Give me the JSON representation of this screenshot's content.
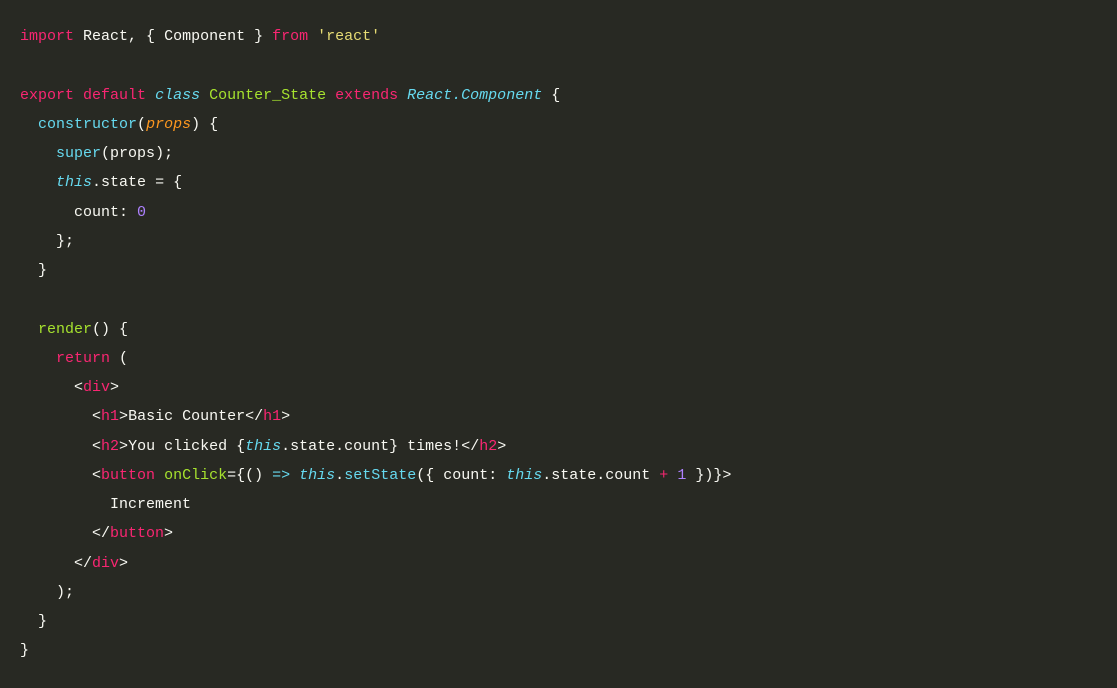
{
  "code": {
    "line1": {
      "import": "import",
      "react": "React",
      "comma": ", { ",
      "component": "Component",
      "close": " } ",
      "from": "from",
      "space": " ",
      "module": "'react'"
    },
    "line3": {
      "export": "export",
      "default": "default",
      "class": "class",
      "className": "Counter_State",
      "extends": "extends",
      "reactComp": "React.Component",
      "brace": " {"
    },
    "line4": {
      "constructor": "constructor",
      "params": "(",
      "props": "props",
      "close": ") {"
    },
    "line5": {
      "super": "super",
      "open": "(",
      "props": "props",
      "close": ");"
    },
    "line6": {
      "this": "this",
      "dot": ".",
      "state": "state",
      "equals": " = {"
    },
    "line7": {
      "count": "count",
      "colon": ": ",
      "zero": "0"
    },
    "line8": {
      "close": "};"
    },
    "line9": {
      "close": "}"
    },
    "line11": {
      "render": "render",
      "parens": "() {"
    },
    "line12": {
      "return": "return",
      "open": " ("
    },
    "line13": {
      "open": "<",
      "div": "div",
      "close": ">"
    },
    "line14": {
      "open1": "<",
      "h1": "h1",
      "close1": ">",
      "text": "Basic Counter",
      "open2": "</",
      "h1b": "h1",
      "close2": ">"
    },
    "line15": {
      "open1": "<",
      "h2": "h2",
      "close1": ">",
      "text1": "You clicked ",
      "braceOpen": "{",
      "this": "this",
      "dotState": ".state.count",
      "braceClose": "}",
      "text2": " times!",
      "open2": "</",
      "h2b": "h2",
      "close2": ">"
    },
    "line16": {
      "open1": "<",
      "button": "button",
      "space": " ",
      "onClick": "onClick",
      "equals": "=",
      "braceOpen": "{",
      "arrow": "() ",
      "arrowOp": "=>",
      "space2": " ",
      "this": "this",
      "dot": ".",
      "setState": "setState",
      "parenOpen": "({ ",
      "count": "count",
      "colon": ": ",
      "this2": "this",
      "dotState": ".state.count ",
      "plus": "+",
      "space3": " ",
      "one": "1",
      "close": " })}",
      "tagClose": ">"
    },
    "line17": {
      "text": "Increment"
    },
    "line18": {
      "open": "</",
      "button": "button",
      "close": ">"
    },
    "line19": {
      "open": "</",
      "div": "div",
      "close": ">"
    },
    "line20": {
      "close": ");"
    },
    "line21": {
      "close": "}"
    },
    "line22": {
      "close": "}"
    }
  }
}
